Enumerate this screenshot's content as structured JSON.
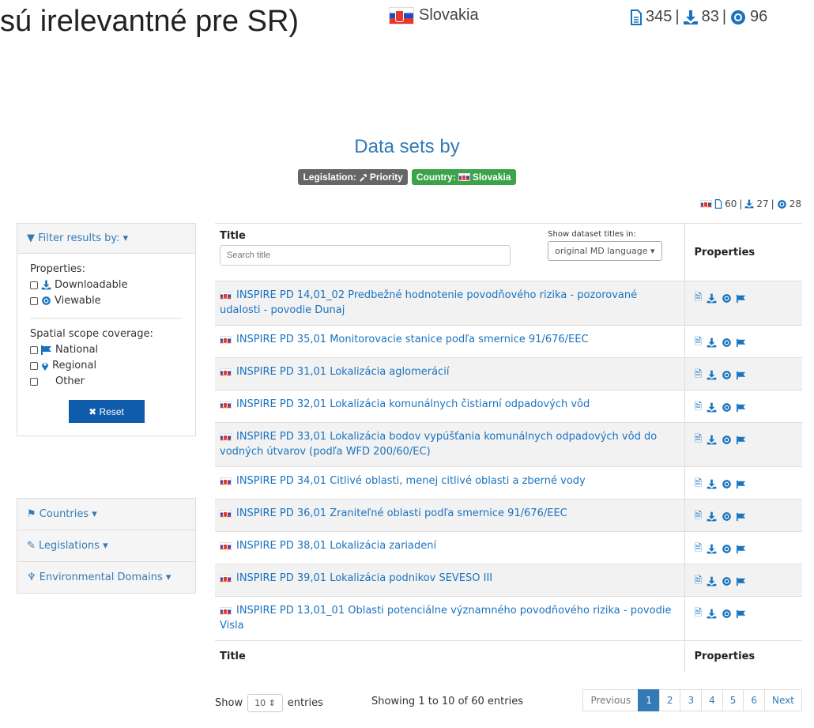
{
  "banner": {
    "title_fragment": "sú irelevantné pre SR)",
    "country": "Slovakia",
    "stats": {
      "documents": "345",
      "downloads": "83",
      "views": "96"
    }
  },
  "heading": "Data sets by",
  "filters": {
    "legislation": {
      "label": "Legislation:",
      "value": "Priority"
    },
    "country": {
      "label": "Country:",
      "value": "Slovakia"
    }
  },
  "summary": {
    "documents": "60",
    "downloads": "27",
    "views": "28"
  },
  "sidebar": {
    "filter_title": "Filter results by:",
    "properties_label": "Properties:",
    "properties": [
      "Downloadable",
      "Viewable"
    ],
    "spatial_label": "Spatial scope coverage:",
    "spatial": [
      "National",
      "Regional",
      "Other"
    ],
    "reset_label": "Reset",
    "accordion": [
      "Countries",
      "Legislations",
      "Environmental Domains"
    ]
  },
  "table": {
    "col_title": "Title",
    "col_properties": "Properties",
    "search_placeholder": "Search title",
    "lang_label": "Show dataset titles in:",
    "lang_value": "original MD language",
    "rows": [
      "INSPIRE PD 14,01_02 Predbežné hodnotenie povodňového rizika - pozorované udalosti - povodie Dunaj",
      "INSPIRE PD 35,01 Monitorovacie stanice podľa smernice 91/676/EEC",
      "INSPIRE PD 31,01 Lokalizácia aglomerácií",
      "INSPIRE PD 32,01 Lokalizácia komunálnych čistiarní odpadových vôd",
      "INSPIRE PD 33,01 Lokalizácia bodov vypúšťania komunálnych odpadových vôd do vodných útvarov (podľa WFD 200/60/EC)",
      "INSPIRE PD 34,01 Citlivé oblasti, menej citlivé oblasti a zberné vody",
      "INSPIRE PD 36,01 Zraniteľné oblasti podľa smernice 91/676/EEC",
      "INSPIRE PD 38,01 Lokalizácia zariadení",
      "INSPIRE PD 39,01 Lokalizácia podnikov SEVESO III",
      "INSPIRE PD 13,01_01 Oblasti potenciálne významného povodňového rizika - povodie Visla"
    ]
  },
  "footer": {
    "show_label": "Show",
    "entries_value": "10",
    "entries_label": "entries",
    "info": "Showing 1 to 10 of 60 entries",
    "prev": "Previous",
    "pages": [
      "1",
      "2",
      "3",
      "4",
      "5",
      "6"
    ],
    "next": "Next"
  }
}
